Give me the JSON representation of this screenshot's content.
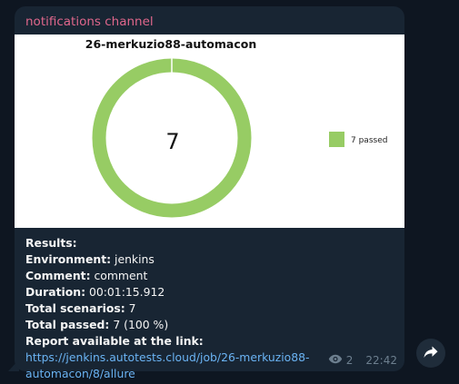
{
  "message": {
    "channel_name": "notifications channel",
    "lines": {
      "results_label": "Results:",
      "environment_label": "Environment:",
      "environment_value": " jenkins",
      "comment_label": "Comment:",
      "comment_value": " comment",
      "duration_label": "Duration:",
      "duration_value": " 00:01:15.912",
      "total_scenarios_label": "Total scenarios:",
      "total_scenarios_value": " 7",
      "total_passed_label": "Total passed:",
      "total_passed_value": " 7 (100 %)",
      "report_label": "Report available at the link:",
      "report_url": "https://jenkins.autotests.cloud/job/26-merkuzio88-automacon/8/allure"
    },
    "views": "2",
    "time": "22:42"
  },
  "chart_data": {
    "type": "pie",
    "donut": true,
    "title": "26-merkuzio88-automacon",
    "center_label": "7",
    "slices": [
      {
        "label": "passed",
        "value": 7,
        "color": "#97cc64"
      }
    ],
    "legend": {
      "position": "right",
      "entries": [
        "7 passed"
      ]
    }
  },
  "icons": {
    "views": "eye-icon",
    "share": "share-arrow-icon"
  },
  "colors": {
    "background": "#0e1621",
    "bubble": "#182533",
    "channel_name": "#e0678c",
    "link": "#6ab3f3",
    "meta": "#6d7f8f",
    "passed": "#97cc64"
  }
}
